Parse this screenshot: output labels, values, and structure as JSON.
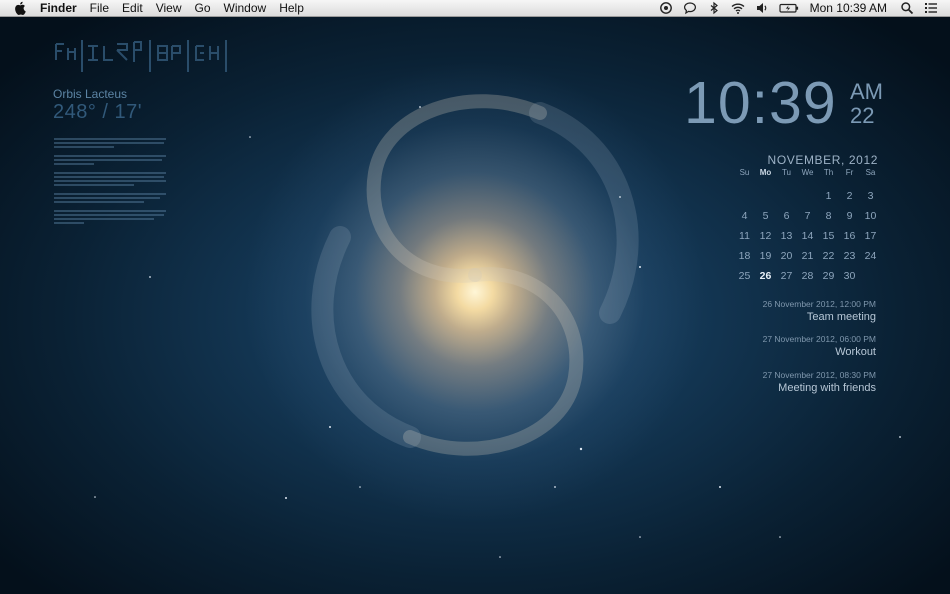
{
  "menubar": {
    "apple_icon": "apple-icon",
    "app_name": "Finder",
    "menus": [
      "File",
      "Edit",
      "View",
      "Go",
      "Window",
      "Help"
    ],
    "status_icons": [
      "time-machine-icon",
      "messages-icon",
      "bluetooth-icon",
      "wifi-icon",
      "volume-icon",
      "battery-icon"
    ],
    "clock": "Mon 10:39 AM",
    "right_icons": [
      "spotlight-search-icon",
      "notification-center-icon"
    ]
  },
  "colors": {
    "menubar_bg": "#e9e9e9",
    "clock_text": "#7c9ab5",
    "calendar_text": "#8ea6bd",
    "widget_title": "#5c84a4"
  },
  "left_widget": {
    "title": "Orbis Lacteus",
    "coords": "248° / 17'"
  },
  "clock_widget": {
    "time": "10:39",
    "ampm": "AM",
    "seconds": "22"
  },
  "calendar": {
    "month": "NOVEMBER, 2012",
    "weekdays": [
      "Su",
      "Mo",
      "Tu",
      "We",
      "Th",
      "Fr",
      "Sa"
    ],
    "weeks": [
      [
        "",
        "",
        "",
        "",
        "1",
        "2",
        "3"
      ],
      [
        "4",
        "5",
        "6",
        "7",
        "8",
        "9",
        "10"
      ],
      [
        "11",
        "12",
        "13",
        "14",
        "15",
        "16",
        "17"
      ],
      [
        "18",
        "19",
        "20",
        "21",
        "22",
        "23",
        "24"
      ],
      [
        "25",
        "26",
        "27",
        "28",
        "29",
        "30",
        ""
      ]
    ],
    "today": "26"
  },
  "events": [
    {
      "date": "26 November 2012, 12:00 PM",
      "title": "Team meeting"
    },
    {
      "date": "27 November 2012, 06:00 PM",
      "title": "Workout"
    },
    {
      "date": "27 November 2012, 08:30 PM",
      "title": "Meeting with friends"
    }
  ]
}
